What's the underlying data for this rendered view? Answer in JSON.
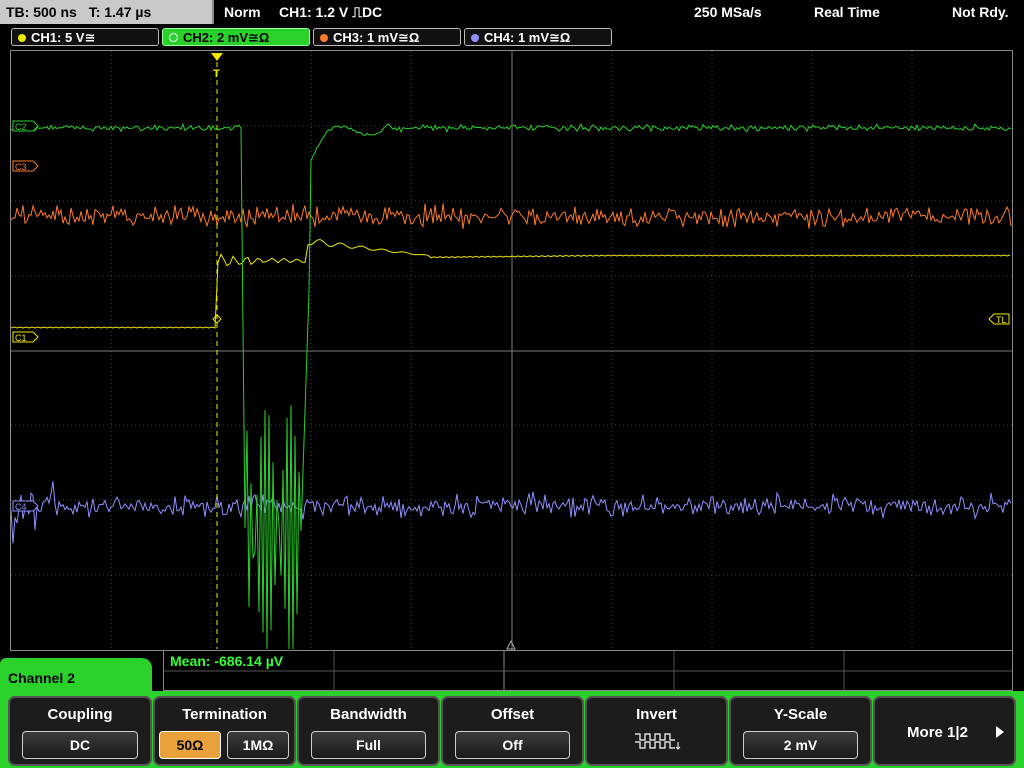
{
  "header": {
    "timebase": "TB: 500 ns",
    "trigger_time": "T: 1.47 µs",
    "mode": "Norm",
    "trigger_info": "CH1: 1.2 V ⎍DC",
    "sample_rate": "250 MSa/s",
    "acq_mode": "Real Time",
    "status": "Not Rdy."
  },
  "channels": [
    {
      "label": "CH1: 5 V≅",
      "color": "#f0e800"
    },
    {
      "label": "CH2: 2 mV≅Ω",
      "color": "#2ad12a",
      "active": true
    },
    {
      "label": "CH3: 1 mV≅Ω",
      "color": "#ff7a2a"
    },
    {
      "label": "CH4: 1 mV≅Ω",
      "color": "#8f8fff"
    }
  ],
  "markers": {
    "c2": "C2",
    "c3": "C3",
    "c1": "C1",
    "c4": "C4",
    "tl": "TL",
    "trigger": "T"
  },
  "measurement": {
    "text": "Mean: -686.14 µV"
  },
  "panel_title": "Channel 2",
  "softkeys": {
    "coupling": {
      "title": "Coupling",
      "value": "DC"
    },
    "termination": {
      "title": "Termination",
      "opt1": "50Ω",
      "opt2": "1MΩ"
    },
    "bandwidth": {
      "title": "Bandwidth",
      "value": "Full"
    },
    "offset": {
      "title": "Offset",
      "value": "Off"
    },
    "invert": {
      "title": "Invert"
    },
    "yscale": {
      "title": "Y-Scale",
      "value": "2 mV"
    },
    "more": {
      "title": "More 1|2"
    }
  }
}
